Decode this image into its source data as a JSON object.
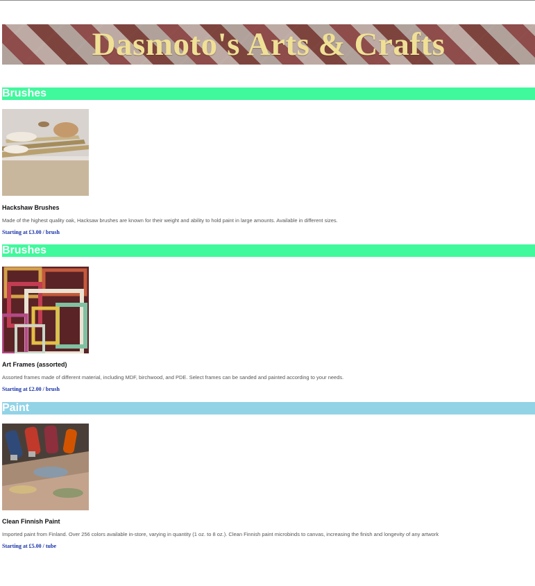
{
  "banner": {
    "title": "Dasmoto's Arts & Crafts"
  },
  "sections": [
    {
      "heading": "Brushes",
      "heading_color": "#3ff99c",
      "image_icon": "brushes-photo",
      "item_name": "Hackshaw Brushes",
      "description": "Made of the highest quality oak, Hacksaw brushes are known for their weight and ability to hold paint in large amounts. Available in different sizes.",
      "price": "Starting at £3.00 / brush"
    },
    {
      "heading": "Brushes",
      "heading_color": "#3ff99c",
      "image_icon": "frames-photo",
      "item_name": "Art Frames (assorted)",
      "description": "Assorted frames made of different material, including MDF, birchwood, and PDE. Select frames can be sanded and painted according to your needs.",
      "price": "Starting at £2.00 / brush"
    },
    {
      "heading": "Paint",
      "heading_color": "#92d3e6",
      "image_icon": "paint-tubes-photo",
      "item_name": "Clean Finnish Paint",
      "description": "Imported paint from Finland. Over 256 colors available in-store, varying in quantity (1 oz. to 8 oz.). Clean Finnish paint microbinds to canvas, increasing the finish and longevity of any artwork",
      "price": "Starting at £5.00 / tube"
    }
  ],
  "colors": {
    "price_text": "#1530a8",
    "banner_text": "#efe096"
  }
}
